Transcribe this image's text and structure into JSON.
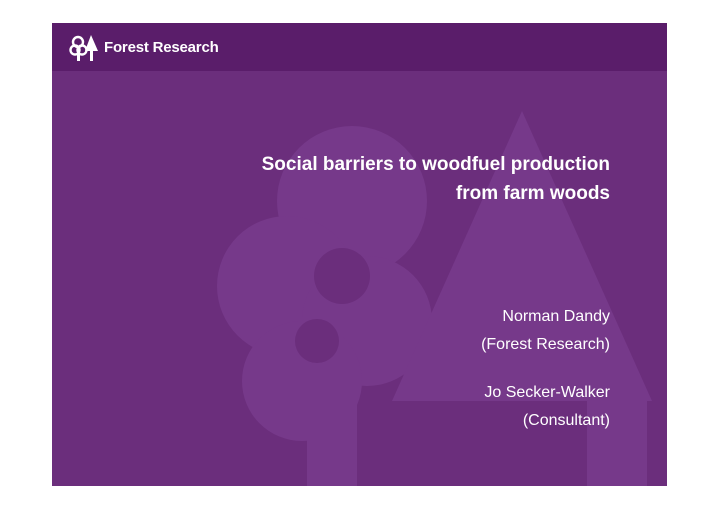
{
  "brand": {
    "name": "Forest Research",
    "logo_icon": "tree-icon",
    "watermark_icon": "tree-watermark-icon"
  },
  "colors": {
    "slide_background": "#6b2e7c",
    "header_band": "#5a1d6a",
    "watermark": "#76398a",
    "text": "#ffffff"
  },
  "title": {
    "line1": "Social barriers to woodfuel production",
    "line2": "from farm woods"
  },
  "authors": [
    {
      "name": "Norman Dandy",
      "affiliation": "(Forest Research)"
    },
    {
      "name": "Jo Secker-Walker",
      "affiliation": "(Consultant)"
    }
  ]
}
